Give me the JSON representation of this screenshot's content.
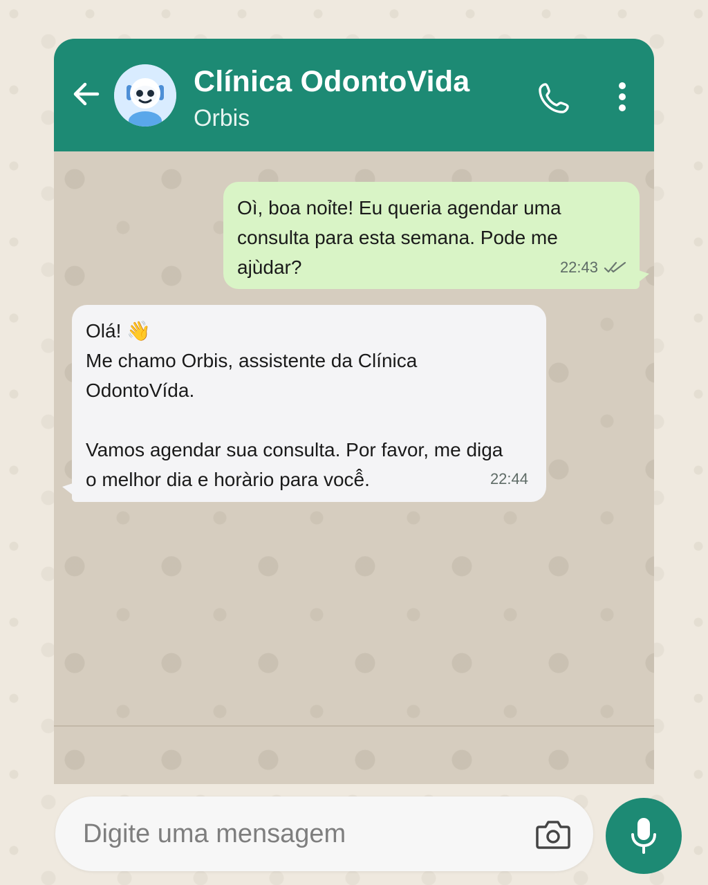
{
  "header": {
    "title": "Clínica OdontoVida",
    "subtitle": "Orbis",
    "icons": {
      "back": "arrow-left-icon",
      "avatar": "robot-avatar",
      "call": "phone-icon",
      "menu": "more-vertical-icon"
    }
  },
  "messages": [
    {
      "direction": "outgoing",
      "text": "Oì, boa noỉte! Eu queria agendar uma\nconsulta para esta semana. Pode me\najùdar?",
      "time": "22:43",
      "status": "read-double-check"
    },
    {
      "direction": "incoming",
      "text": "Olá! 👋\nMe chamo Orbis, assistente da Clínica\nOdontoVída.\n\nVamos agendar sua consulta. Por favor, me diga\no melhor dia e horàrio para você̂.",
      "time": "22:44"
    }
  ],
  "composer": {
    "placeholder": "Digite uma mensagem",
    "value": ""
  },
  "colors": {
    "header": "#1d8a74",
    "outgoing_bubble": "#d9f4c6",
    "incoming_bubble": "#f4f4f6",
    "chat_background": "#d6cdbf",
    "page_background": "#efe9df"
  }
}
